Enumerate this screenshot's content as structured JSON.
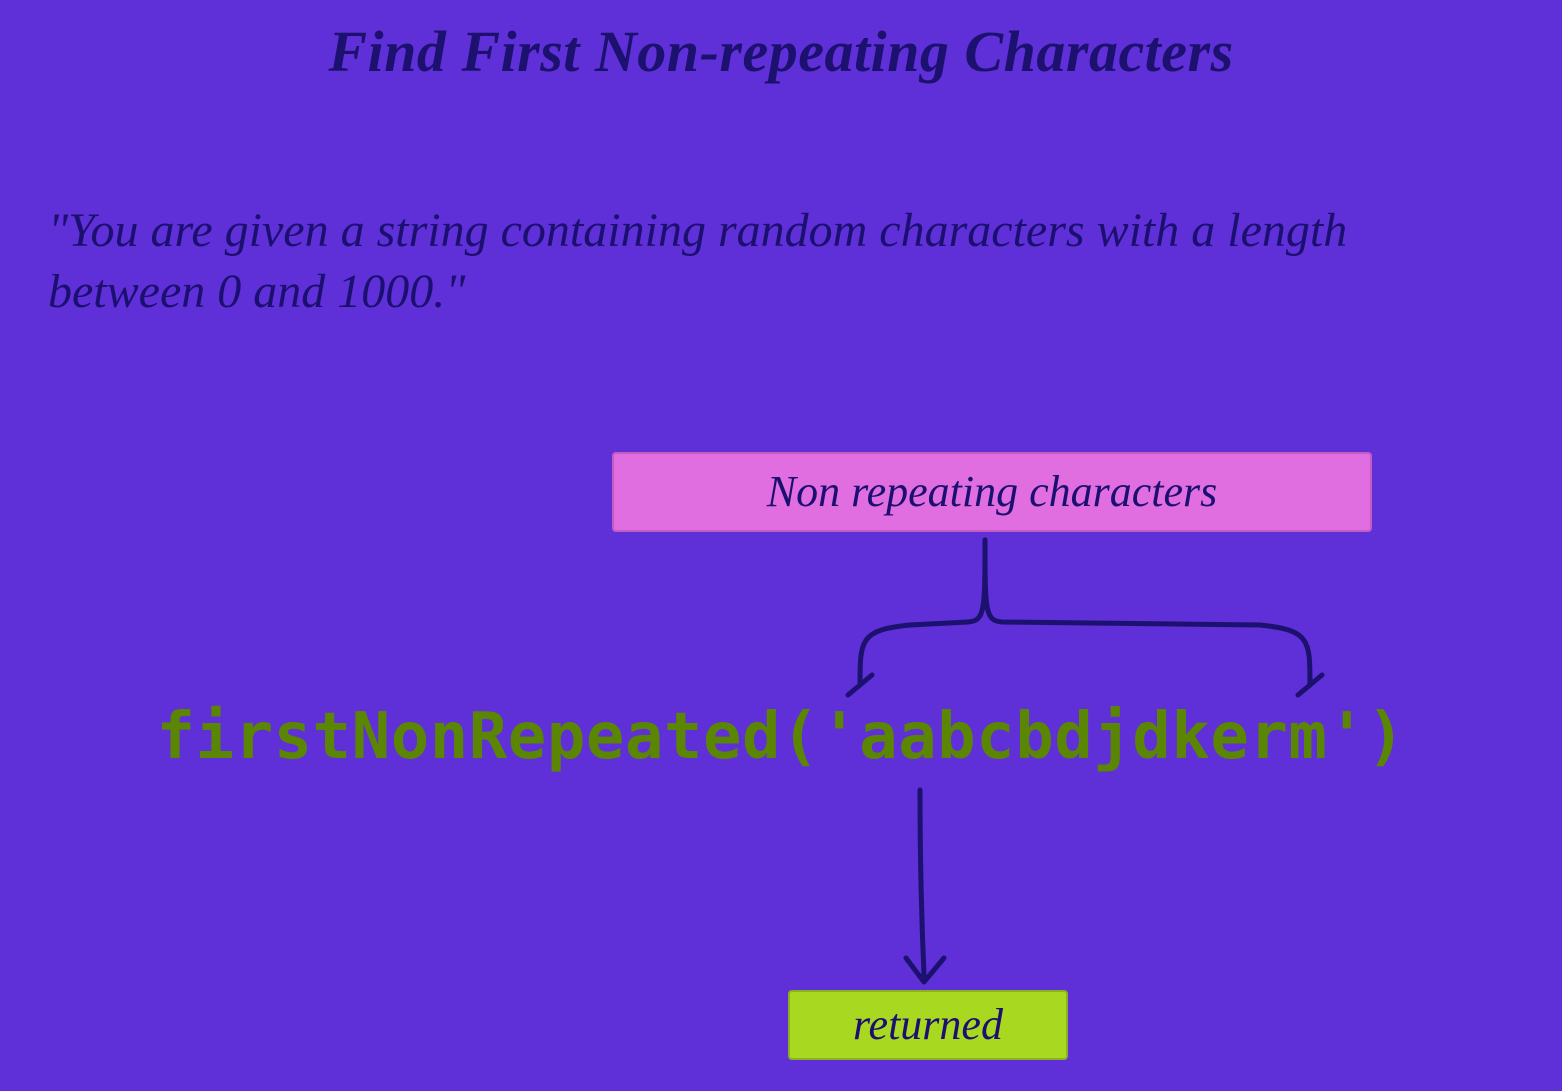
{
  "title": "Find First Non-repeating Characters",
  "description": "\"You are given a string containing random characters with a length between 0 and 1000.\"",
  "labels": {
    "top": "Non repeating characters",
    "bottom": "returned"
  },
  "code": "firstNonRepeated('aabcbdjdkerm')",
  "colors": {
    "background": "#5f2fd8",
    "ink": "#1b1070",
    "code": "#5b8603",
    "pink": "#e16ee0",
    "green": "#a9d821"
  }
}
